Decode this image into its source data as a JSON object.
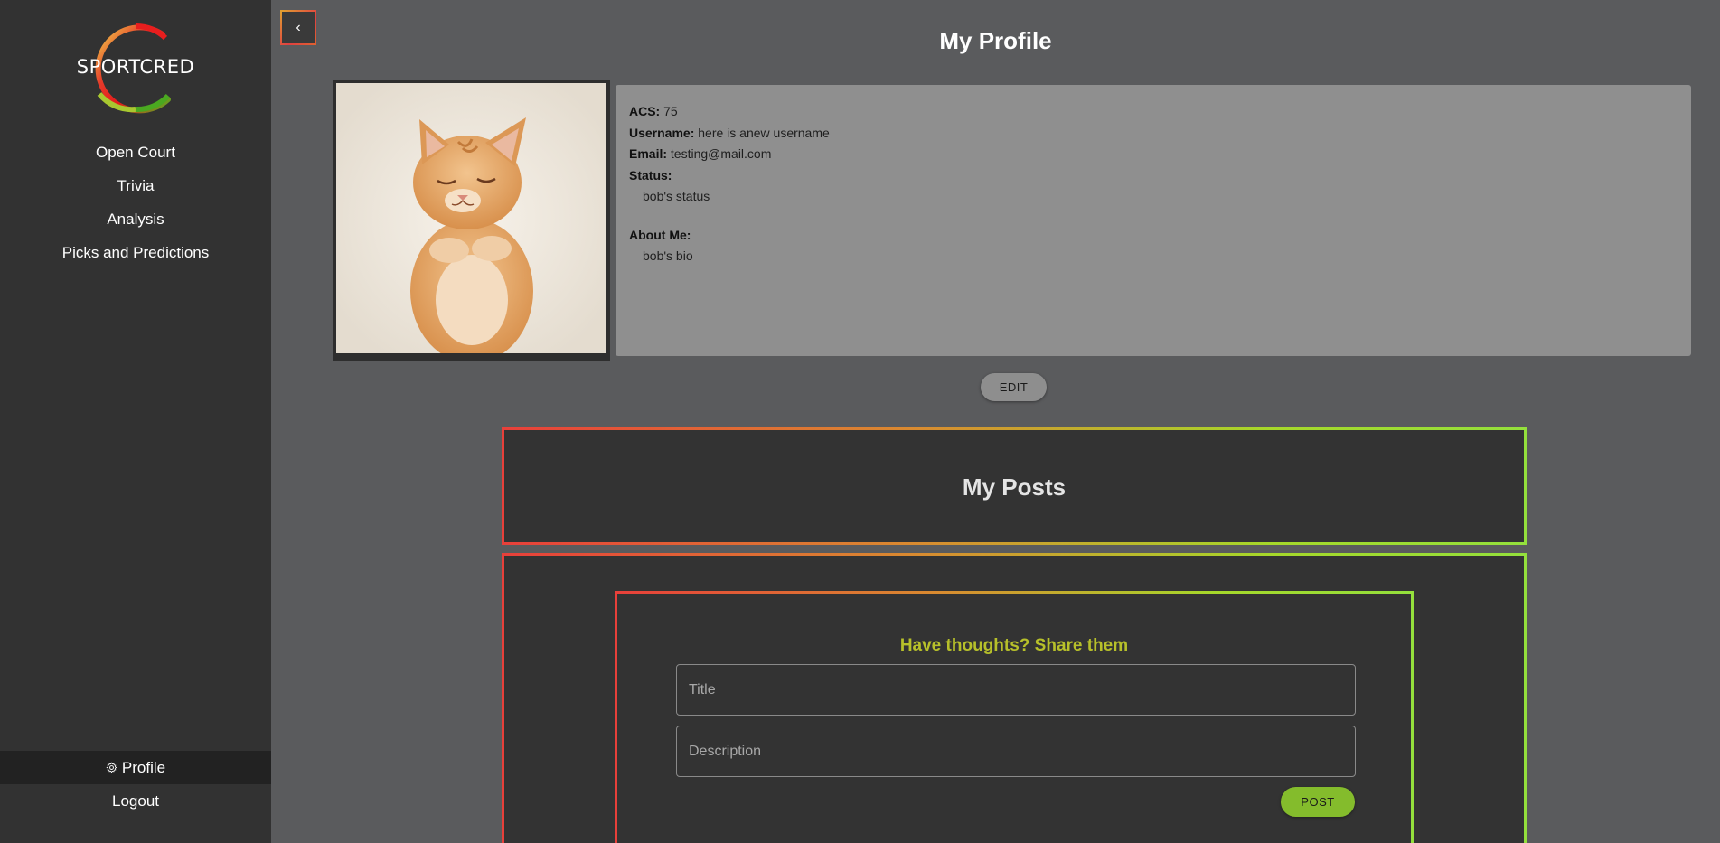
{
  "app": {
    "logo_text": "SPORTCRED"
  },
  "sidebar": {
    "items": [
      {
        "label": "Open Court"
      },
      {
        "label": "Trivia"
      },
      {
        "label": "Analysis"
      },
      {
        "label": "Picks and Predictions"
      }
    ],
    "bottom": [
      {
        "label": "Profile",
        "icon": "gear-icon",
        "active": true
      },
      {
        "label": "Logout"
      }
    ]
  },
  "header": {
    "back_icon": "‹",
    "title": "My Profile"
  },
  "profile": {
    "photo_alt": "sleeping orange kitten",
    "acs_label": "ACS:",
    "acs_value": " 75",
    "username_label": "Username:",
    "username_value": " here is anew username",
    "email_label": "Email:",
    "email_value": " testing@mail.com",
    "status_label": "Status:",
    "status_value": "bob's status",
    "about_label": "About Me:",
    "about_value": "bob's bio",
    "edit_label": "EDIT"
  },
  "posts": {
    "title": "My Posts",
    "share_title": "Have thoughts? Share them",
    "title_placeholder": "Title",
    "description_placeholder": "Description",
    "post_label": "POST"
  },
  "colors": {
    "sidebar_bg": "#323232",
    "page_bg": "#5a5b5d",
    "accent_green": "#84bc2c",
    "share_title": "#b7c02a",
    "gradient_start": "#e8403a",
    "gradient_end": "#94e03c"
  }
}
